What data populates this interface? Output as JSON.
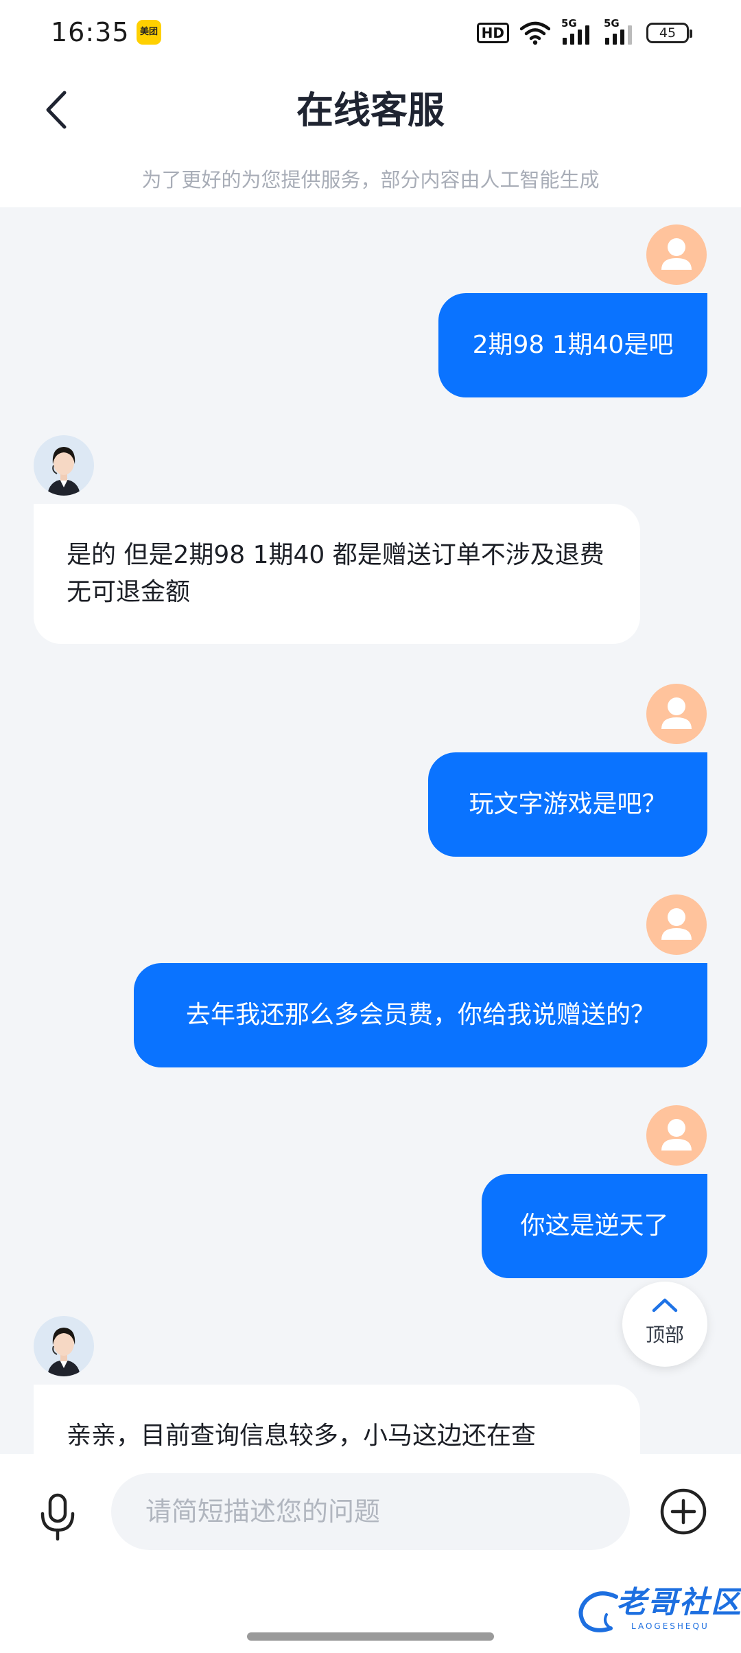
{
  "status_bar": {
    "time": "16:35",
    "notification_app": "美团",
    "hd_label": "HD",
    "network_1": "5G",
    "network_2": "5G",
    "battery": "45"
  },
  "header": {
    "title": "在线客服",
    "subtitle": "为了更好的为您提供服务，部分内容由人工智能生成"
  },
  "messages": [
    {
      "sender": "user",
      "text": "2期98 1期40是吧"
    },
    {
      "sender": "agent",
      "text": "是的 但是2期98 1期40 都是赠送订单不涉及退费 无可退金额"
    },
    {
      "sender": "user",
      "text": "玩文字游戏是吧？"
    },
    {
      "sender": "user",
      "text": "去年我还那么多会员费，你给我说赠送的？"
    },
    {
      "sender": "user",
      "text": "你这是逆天了"
    },
    {
      "sender": "agent",
      "text": "亲亲，目前查询信息较多，小马这边还在查"
    }
  ],
  "scroll_top_label": "顶部",
  "input": {
    "placeholder": "请简短描述您的问题",
    "value": ""
  },
  "watermark": {
    "text": "老哥社区",
    "sub": "LAOGESHEQU"
  },
  "colors": {
    "user_bubble": "#0a73ff",
    "agent_bubble": "#ffffff",
    "chat_background": "#f3f5f8",
    "user_avatar": "#ffc39c"
  },
  "icons": {
    "back": "chevron-left-icon",
    "mic": "microphone-icon",
    "plus": "plus-circle-icon",
    "scroll_top": "chevron-up-icon"
  }
}
